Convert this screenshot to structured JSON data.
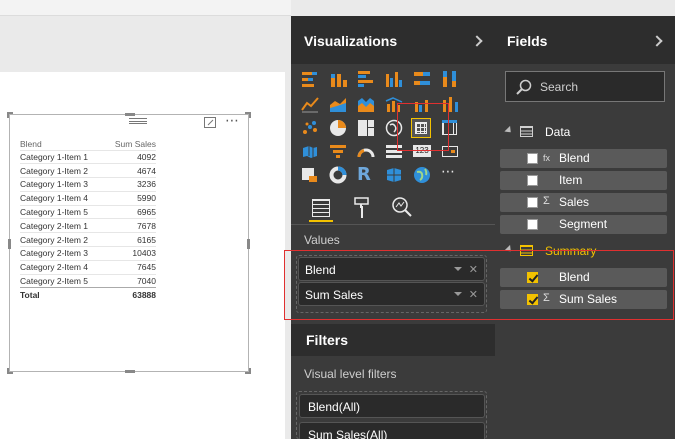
{
  "visualizations": {
    "title": "Visualizations",
    "values_label": "Values",
    "value_wells": [
      "Blend",
      "Sum Sales"
    ]
  },
  "filters": {
    "title": "Filters",
    "level_label": "Visual level filters",
    "items": [
      "Blend(All)",
      "Sum Sales(All)"
    ]
  },
  "fields": {
    "title": "Fields",
    "search_placeholder": "Search",
    "groups": [
      {
        "name": "Data",
        "color": "#ffffff",
        "fields": [
          {
            "label": "Blend",
            "checked": false,
            "kind": "calculated"
          },
          {
            "label": "Item",
            "checked": false,
            "kind": "text"
          },
          {
            "label": "Sales",
            "checked": false,
            "kind": "sum"
          },
          {
            "label": "Segment",
            "checked": false,
            "kind": "text"
          }
        ]
      },
      {
        "name": "Summary",
        "color": "#f3c200",
        "fields": [
          {
            "label": "Blend",
            "checked": true,
            "kind": "text"
          },
          {
            "label": "Sum Sales",
            "checked": true,
            "kind": "sum"
          }
        ]
      }
    ]
  },
  "table_visual": {
    "headers": [
      "Blend",
      "Sum Sales"
    ],
    "rows": [
      [
        "Category 1-Item 1",
        "4092"
      ],
      [
        "Category 1-Item 2",
        "4674"
      ],
      [
        "Category 1-Item 3",
        "3236"
      ],
      [
        "Category 1-Item 4",
        "5990"
      ],
      [
        "Category 1-Item 5",
        "6965"
      ],
      [
        "Category 2-Item 1",
        "7678"
      ],
      [
        "Category 2-Item 2",
        "6165"
      ],
      [
        "Category 2-Item 3",
        "10403"
      ],
      [
        "Category 2-Item 4",
        "7645"
      ],
      [
        "Category 2-Item 5",
        "7040"
      ]
    ],
    "total": [
      "Total",
      "63888"
    ]
  },
  "colors": {
    "accent": "#f3c200",
    "highlight": "#e03030",
    "pane_dark": "#2d2d2d",
    "pane": "#3b3b3b"
  }
}
